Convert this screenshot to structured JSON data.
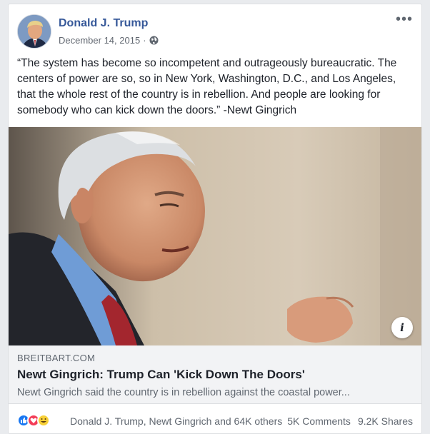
{
  "post": {
    "author": "Donald J. Trump",
    "date": "December 14, 2015",
    "separator": "·",
    "privacy_icon": "globe-icon",
    "more_icon": "more-options-icon",
    "text": "“The system has become so incompetent and outrageously bureaucratic. The centers of power are so, so in New York, Washington, D.C., and Los Angeles, that the whole rest of the country is in rebellion. And people are looking for somebody who can kick down the doors.” -Newt Gingrich"
  },
  "link": {
    "domain": "BREITBART.COM",
    "title": "Newt Gingrich: Trump Can 'Kick Down The Doors'",
    "description": "Newt Gingrich said the country is in rebellion against the coastal power...",
    "info_icon": "info-icon"
  },
  "footer": {
    "reaction_icons": [
      "like-icon",
      "love-icon",
      "haha-icon"
    ],
    "reaction_names": "Donald J. Trump, Newt Gingrich and 64K others",
    "comments": "5K Comments",
    "shares": "9.2K Shares"
  },
  "colors": {
    "author_link": "#365899",
    "like": "#1877f2",
    "love": "#f33e58",
    "haha": "#f7d038"
  }
}
